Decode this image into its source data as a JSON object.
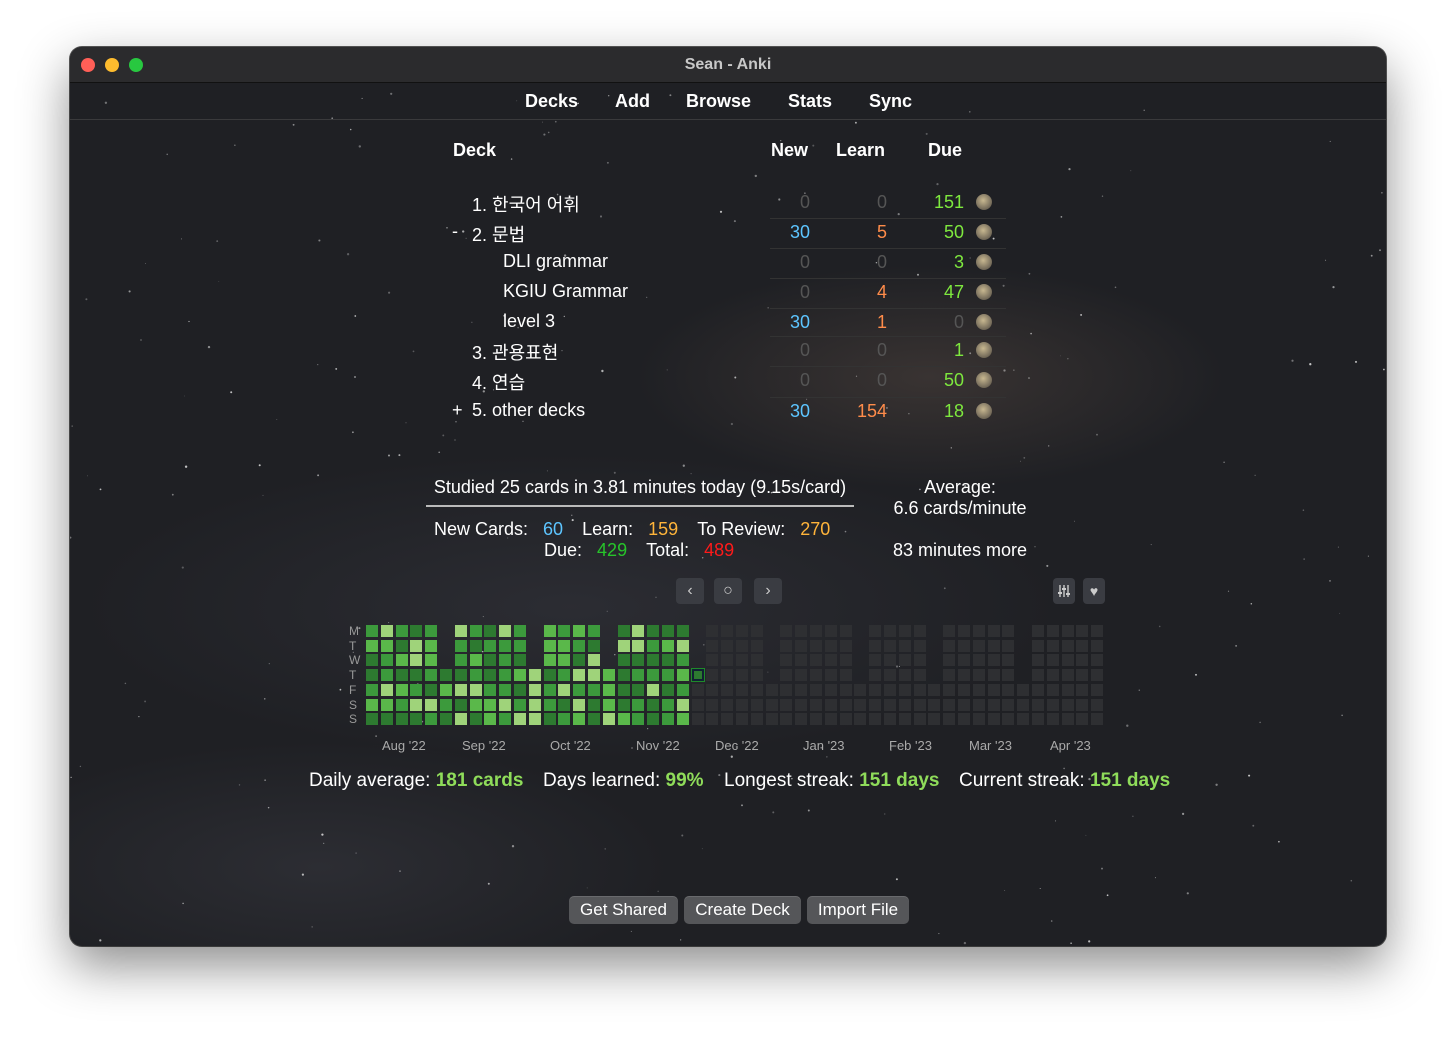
{
  "window": {
    "title": "Sean - Anki"
  },
  "toolbar": {
    "items": [
      "Decks",
      "Add",
      "Browse",
      "Stats",
      "Sync"
    ]
  },
  "decklist": {
    "headers": {
      "deck": "Deck",
      "new": "New",
      "learn": "Learn",
      "due": "Due"
    },
    "rows": [
      {
        "collapse": "",
        "name": "1. 한국어 어휘",
        "new": "0",
        "learn": "0",
        "due": "151"
      },
      {
        "collapse": "-",
        "name": "2. 문법",
        "new": "30",
        "learn": "5",
        "due": "50"
      },
      {
        "collapse": "",
        "name": "DLI grammar",
        "new": "0",
        "learn": "0",
        "due": "3"
      },
      {
        "collapse": "",
        "name": "KGIU Grammar",
        "new": "0",
        "learn": "4",
        "due": "47"
      },
      {
        "collapse": "",
        "name": "level 3",
        "new": "30",
        "learn": "1",
        "due": "0"
      },
      {
        "collapse": "",
        "name": "3. 관용표현",
        "new": "0",
        "learn": "0",
        "due": "1"
      },
      {
        "collapse": "",
        "name": "4. 연습",
        "new": "0",
        "learn": "0",
        "due": "50"
      },
      {
        "collapse": "+",
        "name": "5. other decks",
        "new": "30",
        "learn": "154",
        "due": "18"
      }
    ]
  },
  "today": {
    "studied": "Studied 25 cards in 3.81 minutes today (9.15s/card)",
    "new_label": "New Cards:",
    "new_value": "60",
    "learn_label": "Learn:",
    "learn_value": "159",
    "review_label": "To Review:",
    "review_value": "270",
    "due_label": "Due:",
    "due_value": "429",
    "total_label": "Total:",
    "total_value": "489",
    "average_label": "Average:",
    "average_value": "6.6 cards/minute",
    "more": "83 minutes more"
  },
  "heatmap": {
    "nav_icons": [
      "chevron-left-icon",
      "circle-icon",
      "chevron-right-icon"
    ],
    "option_icons": [
      "sliders-icon",
      "heart-icon"
    ],
    "day_labels": [
      "M",
      "T",
      "W",
      "T",
      "F",
      "S",
      "S"
    ],
    "months": [
      "Aug '22",
      "Sep '22",
      "Oct '22",
      "Nov '22",
      "Dec '22",
      "Jan '23",
      "Feb '23",
      "Mar '23",
      "Apr '23"
    ],
    "colors": {
      "empty": "#2e2f32",
      "l1": "#2d7a30",
      "l2": "#3c9a3c",
      "l3": "#5ab84a",
      "l4": "#9fd37a",
      "today_border": "#1f8a2a"
    }
  },
  "summary": {
    "daily_label": "Daily average:",
    "daily_value": "181 cards",
    "learned_label": "Days learned:",
    "learned_value": "99%",
    "longest_label": "Longest streak:",
    "longest_value": "151 days",
    "current_label": "Current streak:",
    "current_value": "151 days"
  },
  "buttons": {
    "get_shared": "Get Shared",
    "create_deck": "Create Deck",
    "import_file": "Import File"
  },
  "colors": {
    "new": "#5dc5ff",
    "learn": "#ff8c4a",
    "due": "#7ee83e",
    "learn_today": "#ffb43a",
    "due_today": "#27c42a",
    "total_today": "#ff1a1a",
    "summary_value": "#8fdc5a"
  }
}
